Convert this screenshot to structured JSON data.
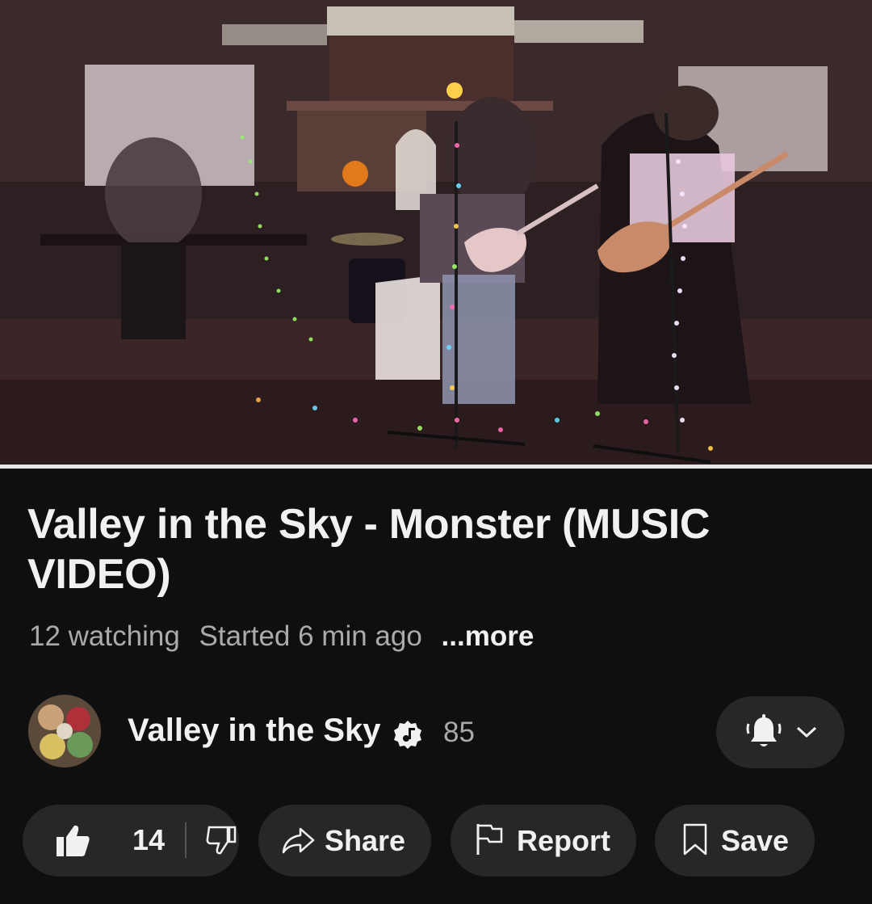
{
  "video": {
    "scene": "Band performing in a living room decorated for Halloween with string lights"
  },
  "info": {
    "title": "Valley in the Sky - Monster (MUSIC VIDEO)",
    "watching": "12 watching",
    "started": "Started 6 min ago",
    "more_label": "...more"
  },
  "channel": {
    "name": "Valley in the Sky",
    "subscribers": "85",
    "icon": "verified-music-badge"
  },
  "actions": {
    "like_count": "14",
    "share_label": "Share",
    "report_label": "Report",
    "save_label": "Save"
  },
  "colors": {
    "background": "#0f0f0f",
    "pill": "#272727",
    "text": "#f1f1f1",
    "secondary_text": "#aaaaaa"
  }
}
